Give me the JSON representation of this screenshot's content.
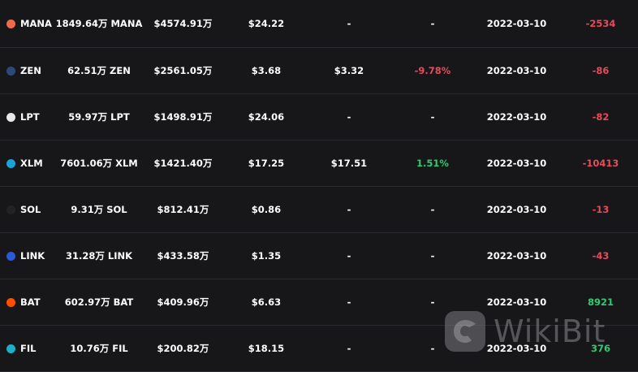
{
  "rows": [
    {
      "symbol": "MANA",
      "icon": "mana-icon",
      "icon_color": "#ef6a4a",
      "amount": "1849.64万 MANA",
      "value": "$4574.91万",
      "price": "$24.22",
      "price2": "-",
      "change": "-",
      "date": "2022-03-10",
      "diff": "-2534",
      "diff_color": "red",
      "change_color": "white"
    },
    {
      "symbol": "ZEN",
      "icon": "zen-icon",
      "icon_color": "#2b4a7a",
      "amount": "62.51万 ZEN",
      "value": "$2561.05万",
      "price": "$3.68",
      "price2": "$3.32",
      "change": "-9.78%",
      "date": "2022-03-10",
      "diff": "-86",
      "diff_color": "red",
      "change_color": "red"
    },
    {
      "symbol": "LPT",
      "icon": "lpt-icon",
      "icon_color": "#e8e8e8",
      "amount": "59.97万 LPT",
      "value": "$1498.91万",
      "price": "$24.06",
      "price2": "-",
      "change": "-",
      "date": "2022-03-10",
      "diff": "-82",
      "diff_color": "red",
      "change_color": "white"
    },
    {
      "symbol": "XLM",
      "icon": "xlm-icon",
      "icon_color": "#1aa3d8",
      "amount": "7601.06万 XLM",
      "value": "$1421.40万",
      "price": "$17.25",
      "price2": "$17.51",
      "change": "1.51%",
      "date": "2022-03-10",
      "diff": "-10413",
      "diff_color": "red",
      "change_color": "green"
    },
    {
      "symbol": "SOL",
      "icon": "sol-icon",
      "icon_color": "#222",
      "amount": "9.31万 SOL",
      "value": "$812.41万",
      "price": "$0.86",
      "price2": "-",
      "change": "-",
      "date": "2022-03-10",
      "diff": "-13",
      "diff_color": "red",
      "change_color": "white"
    },
    {
      "symbol": "LINK",
      "icon": "link-icon",
      "icon_color": "#2a5ada",
      "amount": "31.28万 LINK",
      "value": "$433.58万",
      "price": "$1.35",
      "price2": "-",
      "change": "-",
      "date": "2022-03-10",
      "diff": "-43",
      "diff_color": "red",
      "change_color": "white"
    },
    {
      "symbol": "BAT",
      "icon": "bat-icon",
      "icon_color": "#ff5000",
      "amount": "602.97万 BAT",
      "value": "$409.96万",
      "price": "$6.63",
      "price2": "-",
      "change": "-",
      "date": "2022-03-10",
      "diff": "8921",
      "diff_color": "green",
      "change_color": "white"
    },
    {
      "symbol": "FIL",
      "icon": "fil-icon",
      "icon_color": "#19b0c9",
      "amount": "10.76万 FIL",
      "value": "$200.82万",
      "price": "$18.15",
      "price2": "-",
      "change": "-",
      "date": "2022-03-10",
      "diff": "376",
      "diff_color": "green",
      "change_color": "white"
    }
  ],
  "watermark": {
    "text": "WikiBit"
  }
}
